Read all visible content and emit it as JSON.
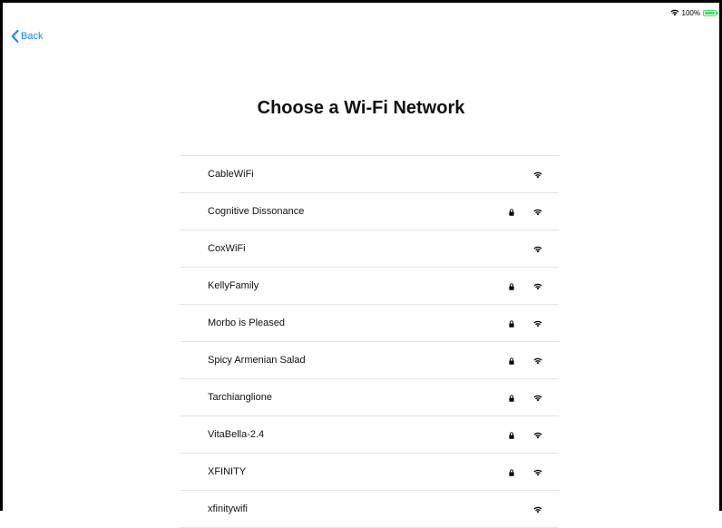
{
  "status_bar": {
    "battery_text": "100%",
    "battery_level": 1.0,
    "wifi_icon": "wifi-icon",
    "battery_color": "#4cd964"
  },
  "nav": {
    "back_label": "Back",
    "accent_color": "#1a82fb"
  },
  "page": {
    "title": "Choose a Wi-Fi Network"
  },
  "networks": [
    {
      "name": "CableWiFi",
      "secured": false,
      "signal": "wifi-icon"
    },
    {
      "name": "Cognitive Dissonance",
      "secured": true,
      "signal": "wifi-icon"
    },
    {
      "name": "CoxWiFi",
      "secured": false,
      "signal": "wifi-icon"
    },
    {
      "name": "KellyFamily",
      "secured": true,
      "signal": "wifi-icon"
    },
    {
      "name": "Morbo is Pleased",
      "secured": true,
      "signal": "wifi-icon"
    },
    {
      "name": "Spicy Armenian Salad",
      "secured": true,
      "signal": "wifi-icon"
    },
    {
      "name": "Tarchianglione",
      "secured": true,
      "signal": "wifi-icon"
    },
    {
      "name": "VitaBella-2.4",
      "secured": true,
      "signal": "wifi-icon"
    },
    {
      "name": "XFINITY",
      "secured": true,
      "signal": "wifi-icon"
    },
    {
      "name": "xfinitywifi",
      "secured": false,
      "signal": "wifi-icon"
    }
  ]
}
